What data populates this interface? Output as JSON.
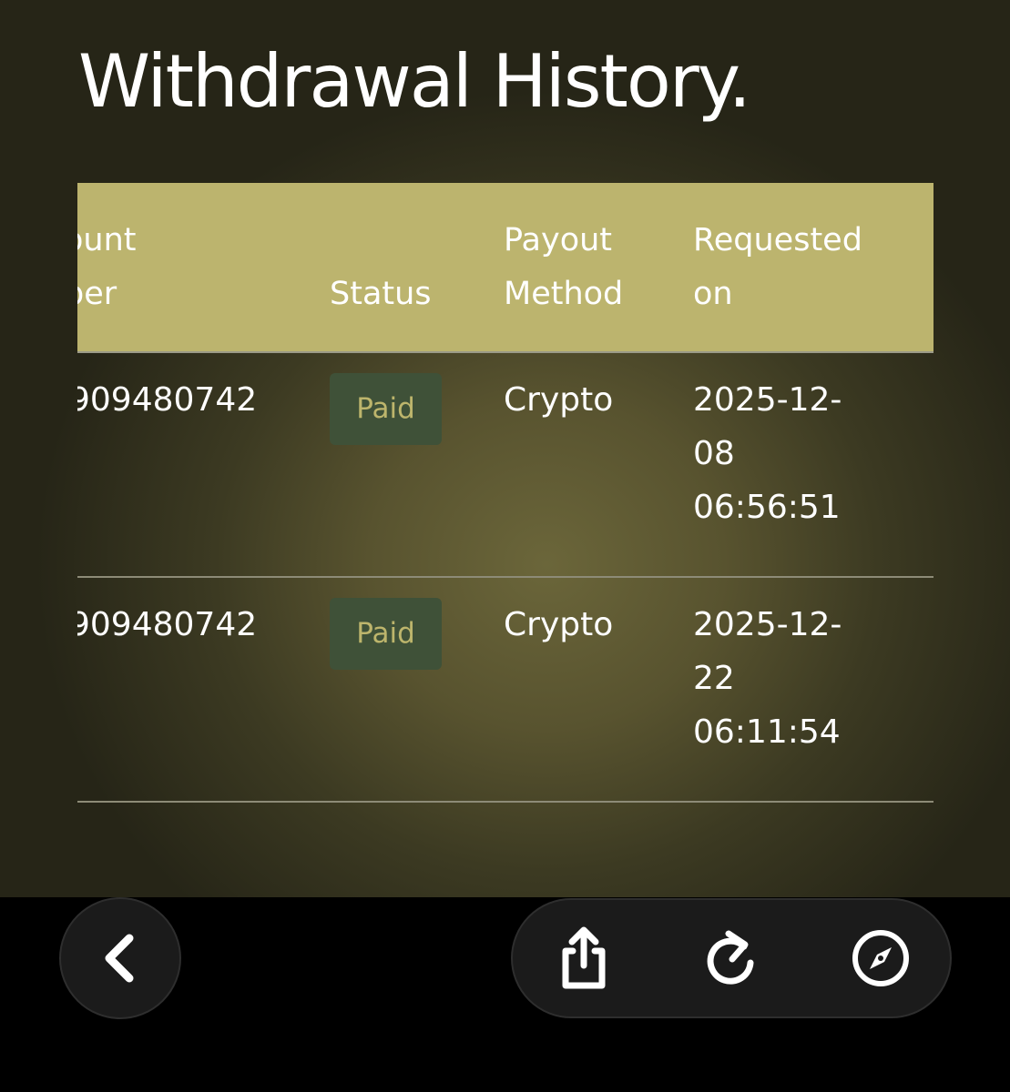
{
  "page": {
    "title": "Withdrawal History."
  },
  "table": {
    "headers": {
      "account_line1": "ount",
      "account_line2": "ber",
      "status": "Status",
      "method_line1": "Payout",
      "method_line2": "Method",
      "requested_line1": "Requested",
      "requested_line2": "on"
    },
    "rows": [
      {
        "account": "909480742",
        "status": "Paid",
        "method": "Crypto",
        "requested_line1": "2025-12-",
        "requested_line2": "08",
        "requested_line3": "06:56:51"
      },
      {
        "account": "909480742",
        "status": "Paid",
        "method": "Crypto",
        "requested_line1": "2025-12-",
        "requested_line2": "22",
        "requested_line3": "06:11:54"
      }
    ]
  },
  "nav": {
    "back_icon": "chevron-left-icon",
    "share_icon": "share-icon",
    "reload_icon": "reload-icon",
    "compass_icon": "compass-icon"
  },
  "colors": {
    "header_bg": "#bcb46e",
    "badge_bg": "#3f5138",
    "badge_text": "#bdb56c"
  }
}
